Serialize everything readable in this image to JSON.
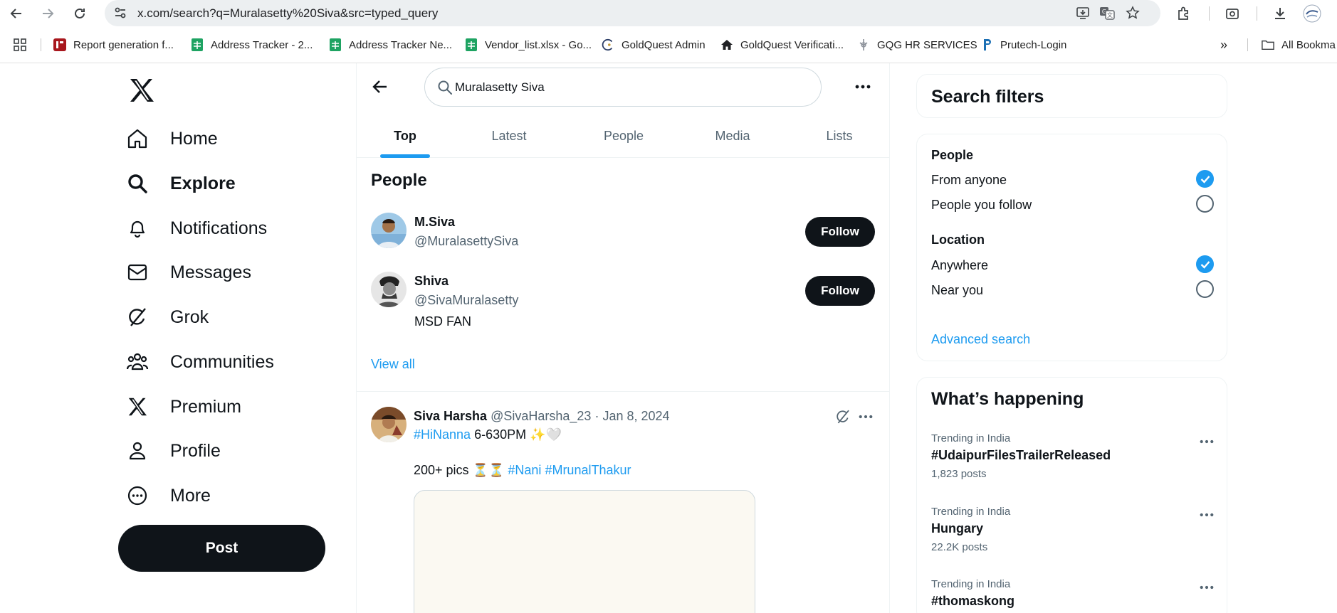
{
  "browser": {
    "url": "x.com/search?q=Muralasetty%20Siva&src=typed_query",
    "bookmarks": [
      {
        "label": "Report generation f...",
        "icon": "report-icon"
      },
      {
        "label": "Address Tracker - 2...",
        "icon": "sheets-icon"
      },
      {
        "label": "Address Tracker Ne...",
        "icon": "sheets-icon"
      },
      {
        "label": "Vendor_list.xlsx - Go...",
        "icon": "sheets-icon"
      },
      {
        "label": "GoldQuest Admin",
        "icon": "goldquest-icon"
      },
      {
        "label": "GoldQuest Verificati...",
        "icon": "home-icon"
      },
      {
        "label": "GQG HR SERVICES",
        "icon": "gqg-icon"
      },
      {
        "label": "Prutech-Login",
        "icon": "prutech-icon"
      }
    ],
    "all_bookmarks_label": "All Bookma"
  },
  "nav": {
    "items": [
      {
        "label": "Home",
        "icon": "home-icon"
      },
      {
        "label": "Explore",
        "icon": "search-icon"
      },
      {
        "label": "Notifications",
        "icon": "bell-icon"
      },
      {
        "label": "Messages",
        "icon": "envelope-icon"
      },
      {
        "label": "Grok",
        "icon": "grok-icon"
      },
      {
        "label": "Communities",
        "icon": "communities-icon"
      },
      {
        "label": "Premium",
        "icon": "x-logo-icon"
      },
      {
        "label": "Profile",
        "icon": "person-icon"
      },
      {
        "label": "More",
        "icon": "more-circle-icon"
      }
    ],
    "active": "Explore",
    "post_label": "Post"
  },
  "search": {
    "query": "Muralasetty Siva"
  },
  "tabs": [
    "Top",
    "Latest",
    "People",
    "Media",
    "Lists"
  ],
  "people_section": {
    "title": "People",
    "people": [
      {
        "name": "M.Siva",
        "handle": "@MuralasettySiva",
        "bio": "",
        "follow_label": "Follow"
      },
      {
        "name": "Shiva",
        "handle": "@SivaMuralasetty",
        "bio": "MSD FAN",
        "follow_label": "Follow"
      }
    ],
    "view_all": "View all"
  },
  "tweet": {
    "name": "Siva Harsha",
    "handle": "@SivaHarsha_23",
    "separator": "·",
    "date": "Jan 8, 2024",
    "line1_tag": "#HiNanna",
    "line1_text": " 6-630PM ✨🤍",
    "line2_text": "200+ pics ⏳⏳ ",
    "line2_tag1": "#Nani",
    "line2_tag2": "#MrunalThakur"
  },
  "filters": {
    "title": "Search filters",
    "people_label": "People",
    "people_options": [
      "From anyone",
      "People you follow"
    ],
    "people_selected": 0,
    "location_label": "Location",
    "location_options": [
      "Anywhere",
      "Near you"
    ],
    "location_selected": 0,
    "advanced": "Advanced search"
  },
  "happening": {
    "title": "What’s happening",
    "trends": [
      {
        "context": "Trending in India",
        "topic": "#UdaipurFilesTrailerReleased",
        "count": "1,823 posts"
      },
      {
        "context": "Trending in India",
        "topic": "Hungary",
        "count": "22.2K posts"
      },
      {
        "context": "Trending in India",
        "topic": "#thomaskong",
        "count": ""
      }
    ]
  },
  "colors": {
    "accent": "#1d9bf0",
    "text": "#0f1419",
    "muted": "#536471",
    "button": "#0f1419"
  }
}
